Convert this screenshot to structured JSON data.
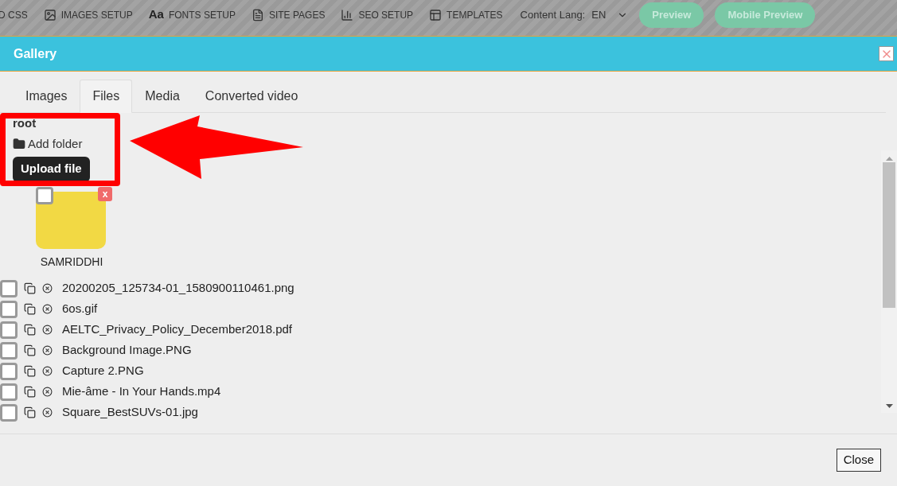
{
  "toolbar": {
    "items": [
      {
        "kind": "text",
        "label": "D CSS"
      },
      {
        "kind": "image",
        "label": "IMAGES SETUP"
      },
      {
        "kind": "glyph",
        "glyph": "Aa",
        "label": "FONTS SETUP"
      },
      {
        "kind": "page",
        "label": "SITE PAGES"
      },
      {
        "kind": "chart",
        "label": "SEO SETUP"
      },
      {
        "kind": "layout",
        "label": "TEMPLATES"
      }
    ],
    "content_lang": {
      "label": "Content Lang:",
      "value": "EN"
    },
    "buttons": [
      "Preview",
      "Mobile Preview"
    ]
  },
  "dialog": {
    "title": "Gallery",
    "tabs": [
      {
        "label": "Images",
        "selected": false
      },
      {
        "label": "Files",
        "selected": true
      },
      {
        "label": "Media",
        "selected": false
      },
      {
        "label": "Converted video",
        "selected": false
      }
    ],
    "path": "root",
    "add_folder": "Add folder",
    "upload_file": "Upload file",
    "folders": [
      {
        "name": "SAMRIDDHI",
        "checked": false,
        "delete": "x"
      }
    ],
    "files": [
      {
        "name": "20200205_125734-01_1580900110461.png",
        "checked": false
      },
      {
        "name": "6os.gif",
        "checked": false
      },
      {
        "name": "AELTC_Privacy_Policy_December2018.pdf",
        "checked": false
      },
      {
        "name": "Background Image.PNG",
        "checked": false
      },
      {
        "name": "Capture 2.PNG",
        "checked": false
      },
      {
        "name": "Mie-âme - In Your Hands.mp4",
        "checked": false
      },
      {
        "name": "Square_BestSUVs-01.jpg",
        "checked": false
      }
    ],
    "close": "Close"
  }
}
